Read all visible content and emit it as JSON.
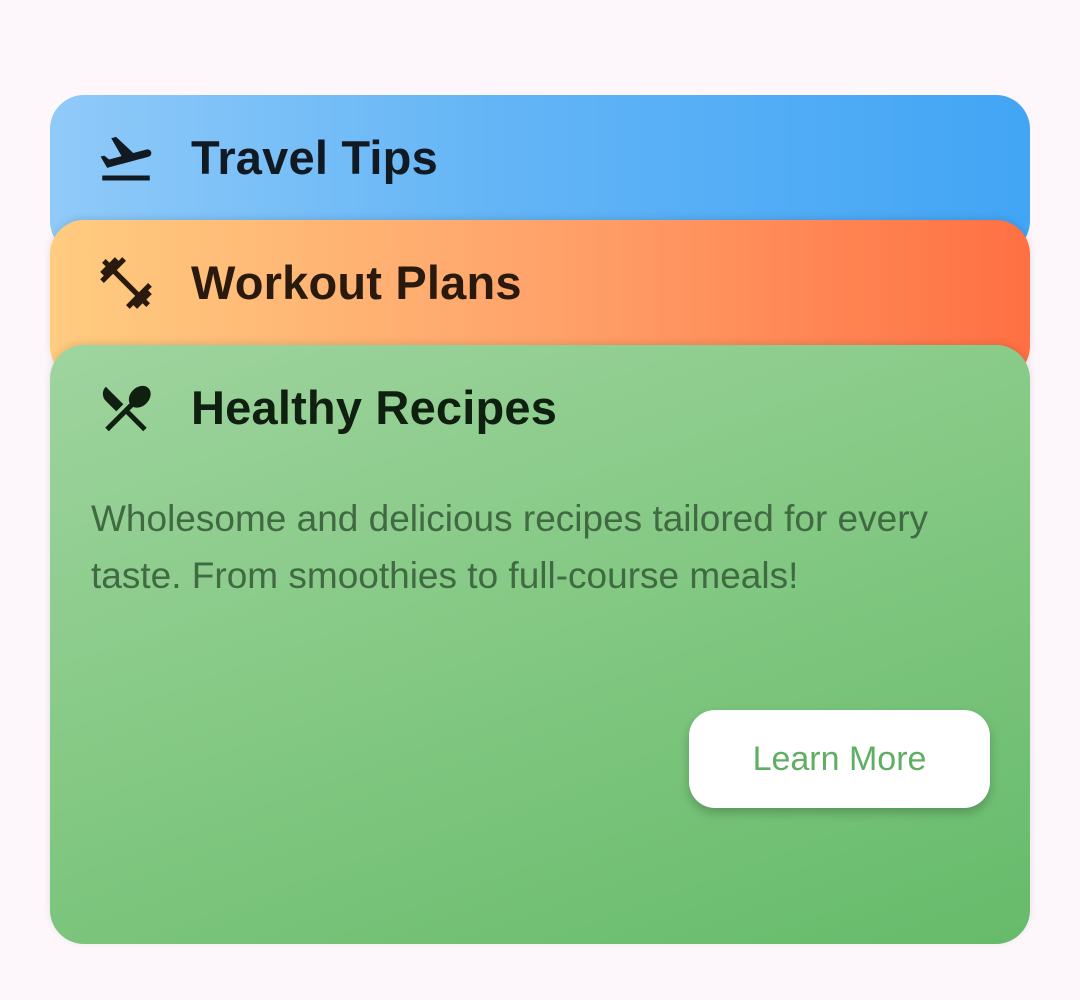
{
  "cards": [
    {
      "title": "Travel Tips",
      "icon": "flight-takeoff-icon",
      "colors": [
        "#90caf9",
        "#42a5f5"
      ]
    },
    {
      "title": "Workout Plans",
      "icon": "dumbbell-icon",
      "colors": [
        "#ffcc80",
        "#ff7043"
      ]
    },
    {
      "title": "Healthy Recipes",
      "icon": "restaurant-icon",
      "colors": [
        "#a5d6a7",
        "#66bb6a"
      ],
      "description": "Wholesome and delicious recipes tailored for every taste. From smoothies to full-course meals!",
      "button_label": "Learn More"
    }
  ],
  "colors": {
    "background": "#fdf7fc",
    "button_text": "#5fae63"
  }
}
